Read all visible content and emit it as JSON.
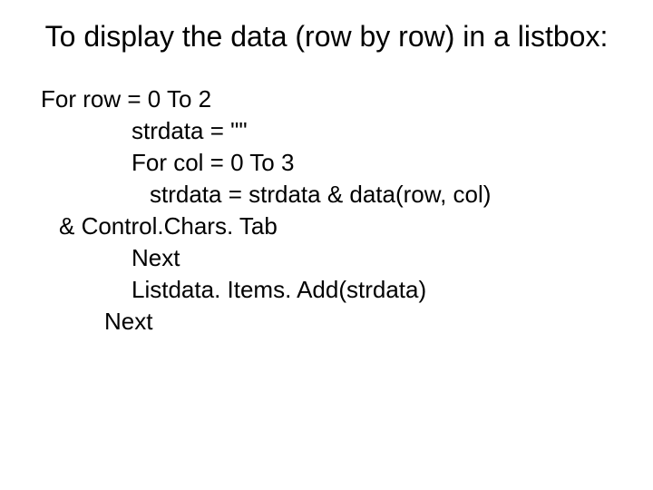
{
  "title": "To display the data (row by row) in a listbox:",
  "code": {
    "line1": "For row = 0 To 2",
    "line2": "strdata = \"\"",
    "line3": "For col = 0 To 3",
    "line4": "strdata = strdata & data(row, col)",
    "line5": "& Control.Chars. Tab",
    "line6": "Next",
    "line7": "Listdata. Items. Add(strdata)",
    "line8": "Next"
  }
}
